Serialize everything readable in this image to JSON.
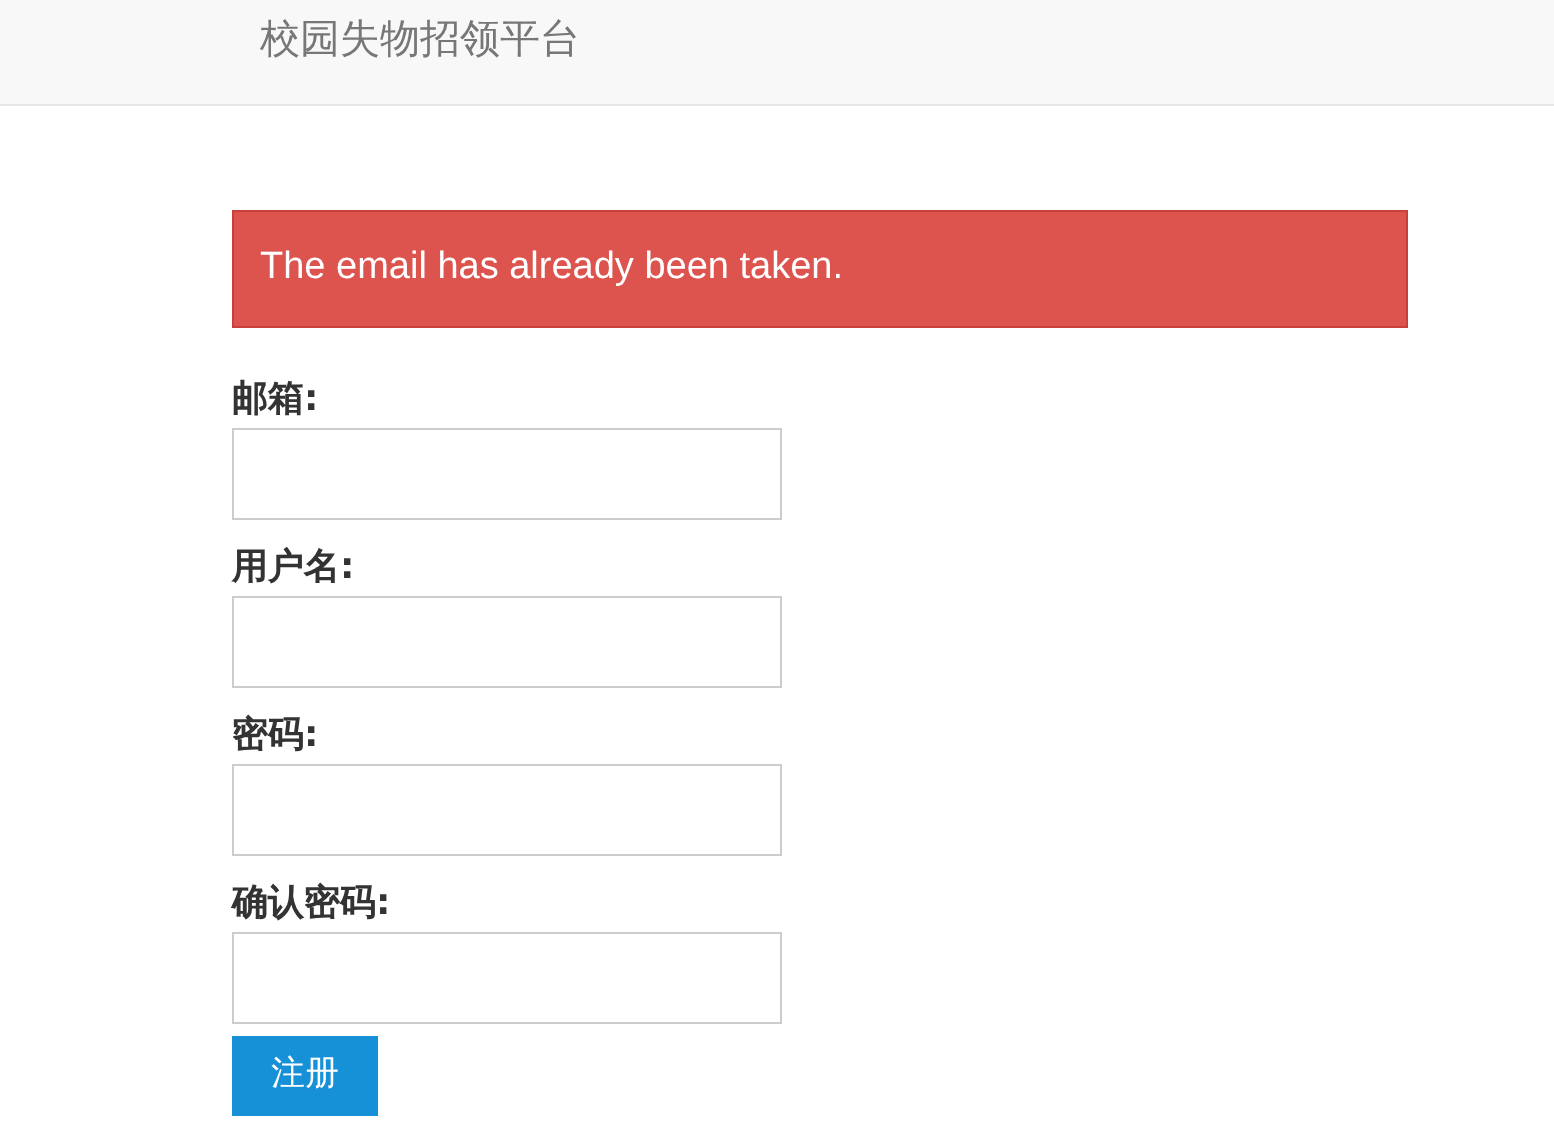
{
  "navbar": {
    "brand": "校园失物招领平台"
  },
  "alert": {
    "message": "The email has already been taken."
  },
  "form": {
    "fields": [
      {
        "label": "邮箱:"
      },
      {
        "label": "用户名:"
      },
      {
        "label": "密码:"
      },
      {
        "label": "确认密码:"
      }
    ],
    "submit": "注册"
  }
}
